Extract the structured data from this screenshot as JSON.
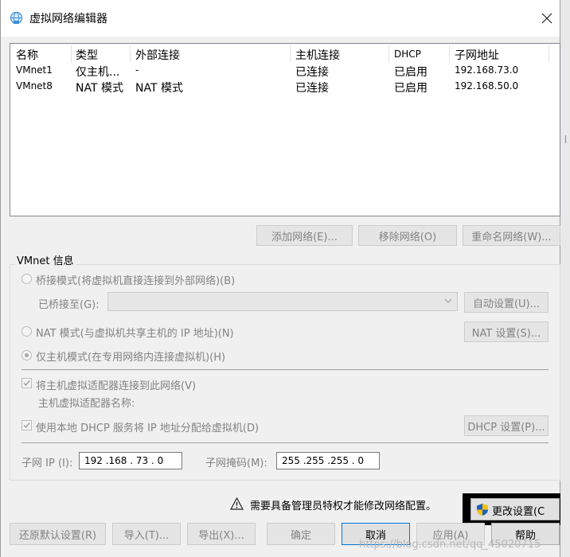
{
  "window": {
    "title": "虚拟网络编辑器",
    "close_glyph": "✕"
  },
  "network_list": {
    "headers": [
      "名称",
      "类型",
      "外部连接",
      "主机连接",
      "DHCP",
      "子网地址"
    ],
    "rows": [
      [
        "VMnet1",
        "仅主机...",
        "-",
        "已连接",
        "已启用",
        "192.168.73.0"
      ],
      [
        "VMnet8",
        "NAT 模式",
        "NAT 模式",
        "已连接",
        "已启用",
        "192.168.50.0"
      ]
    ]
  },
  "list_buttons": {
    "add": "添加网络(E)...",
    "remove": "移除网络(O)",
    "rename": "重命名网络(W)..."
  },
  "vmnet_info": {
    "title": "VMnet 信息",
    "bridge_mode": "桥接模式(将虚拟机直接连接到外部网络)(B)",
    "bridged_to_label": "已桥接至(G):",
    "auto_settings": "自动设置(U)...",
    "nat_mode": "NAT 模式(与虚拟机共享主机的 IP 地址)(N)",
    "nat_settings": "NAT 设置(S)...",
    "host_only_mode": "仅主机模式(在专用网络内连接虚拟机)(H)",
    "connect_adapter": "将主机虚拟适配器连接到此网络(V)",
    "adapter_name_label": "主机虚拟适配器名称:",
    "use_dhcp": "使用本地 DHCP 服务将 IP 地址分配给虚拟机(D)",
    "dhcp_settings": "DHCP 设置(P)...",
    "subnet_ip_label": "子网 IP (I):",
    "subnet_ip": "192 .168 . 73 . 0",
    "subnet_mask_label": "子网掩码(M):",
    "subnet_mask": "255 .255 .255 . 0"
  },
  "admin_notice": "需要具备管理员特权才能修改网络配置。",
  "change_settings": "更改设置(C",
  "bottom_buttons": {
    "restore": "还原默认设置(R)",
    "import": "导入(T)...",
    "export": "导出(X)...",
    "ok": "确定",
    "cancel": "取消",
    "apply": "应用(A)",
    "help": "帮助"
  },
  "watermark": "https://blog.csdn.net/qq_45020715",
  "colors": {
    "accent": "#0078d7",
    "disabled_text": "#838383",
    "shield_blue": "#1f5fbf",
    "shield_yellow": "#f5c400"
  }
}
